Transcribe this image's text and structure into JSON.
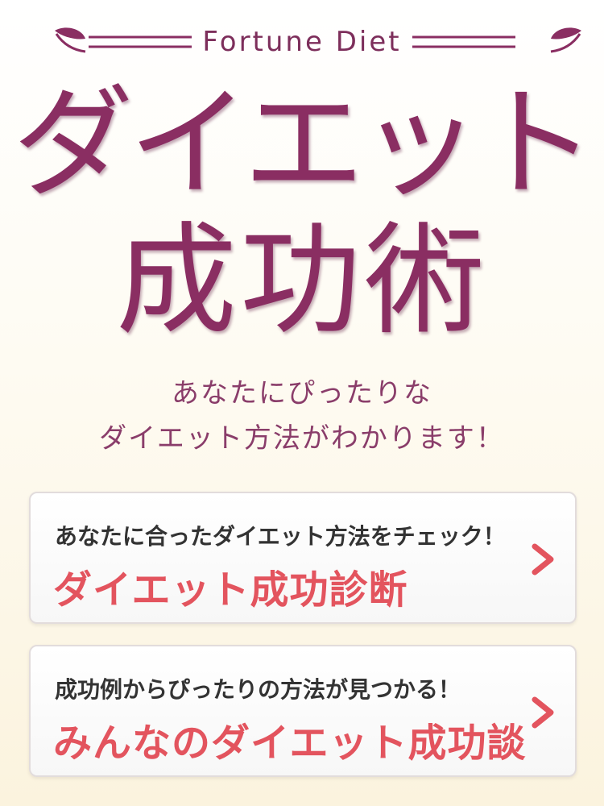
{
  "brand": "Fortune Diet",
  "hero": {
    "line1": "ダイエット",
    "line2": "成功術"
  },
  "subtitle": {
    "line1": "あなたにぴったりな",
    "line2": "ダイエット方法がわかります！"
  },
  "cards": [
    {
      "lead": "あなたに合ったダイエット方法をチェック！",
      "title": "ダイエット成功診断"
    },
    {
      "lead": "成功例からぴったりの方法が見つかる！",
      "title": "みんなのダイエット成功談"
    }
  ],
  "colors": {
    "brand_purple": "#8a2e62",
    "accent_red": "#e3545e",
    "background": "#fefbf2"
  },
  "icons": {
    "ornament": "leaf-flourish-icon",
    "card_arrow": "chevron-right-icon"
  }
}
